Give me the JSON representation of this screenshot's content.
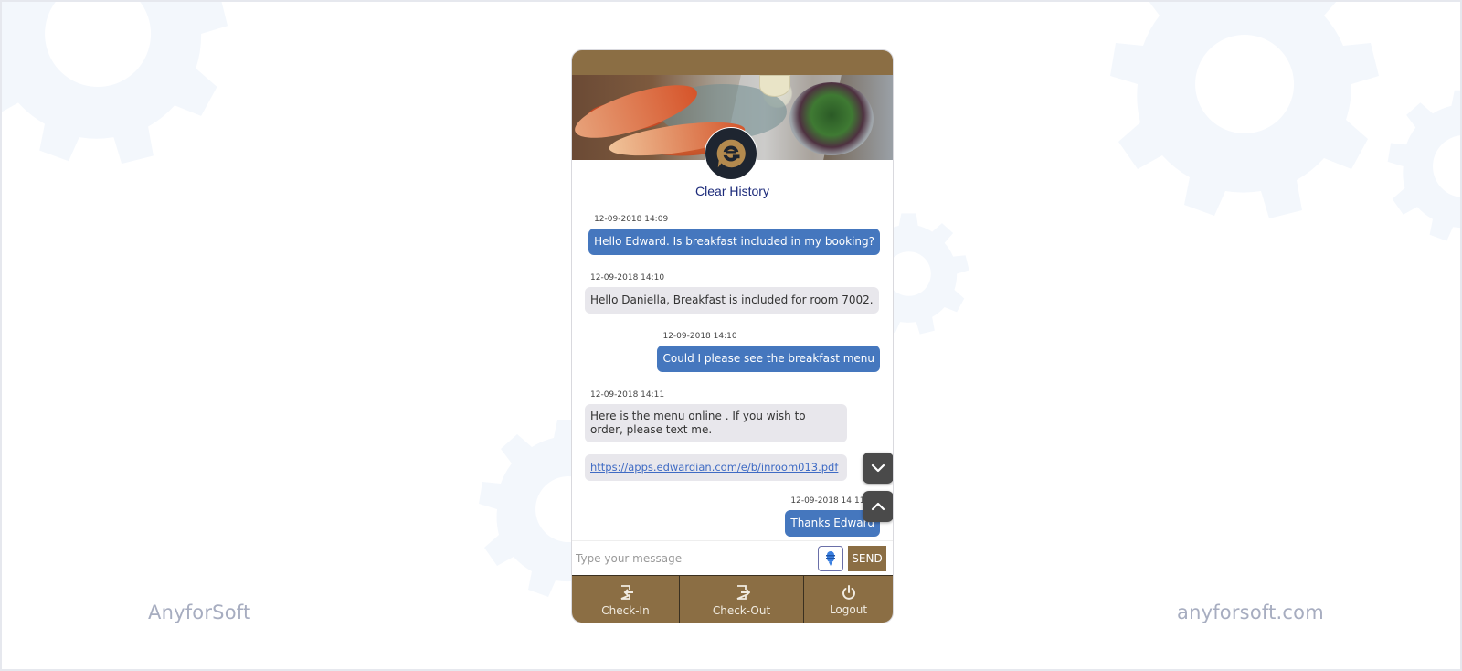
{
  "branding": {
    "left": "AnyforSoft",
    "right": "anyforsoft.com"
  },
  "app": {
    "accent_color": "#8b6e44",
    "clear_history_label": "Clear History",
    "logo_icon": "chat-bubble-e-logo"
  },
  "messages": [
    {
      "direction": "outgoing",
      "timestamp": "12-09-2018 14:09",
      "text": "Hello Edward. Is breakfast included in my booking?"
    },
    {
      "direction": "incoming",
      "timestamp": "12-09-2018 14:10",
      "text": "Hello Daniella, Breakfast is included for room 7002."
    },
    {
      "direction": "outgoing",
      "timestamp": "12-09-2018 14:10",
      "text": "Could I please see the breakfast menu"
    },
    {
      "direction": "incoming",
      "timestamp": "12-09-2018 14:11",
      "text": "Here is the menu online . If you wish to order, please text me."
    },
    {
      "direction": "incoming",
      "timestamp": "",
      "text": "https://apps.edwardian.com/e/b/inroom013.pdf",
      "is_link": true
    },
    {
      "direction": "outgoing",
      "timestamp": "12-09-2018 14:11",
      "text": "Thanks Edward"
    }
  ],
  "scroll_buttons": {
    "down_icon": "chevron-down-icon",
    "up_icon": "chevron-up-icon"
  },
  "composer": {
    "placeholder": "Type your message",
    "value": "",
    "mic_icon": "microphone-icon",
    "send_label": "SEND"
  },
  "bottom_nav": [
    {
      "label": "Check-In",
      "icon": "check-in-icon"
    },
    {
      "label": "Check-Out",
      "icon": "check-out-icon"
    },
    {
      "label": "Logout",
      "icon": "power-icon"
    }
  ]
}
